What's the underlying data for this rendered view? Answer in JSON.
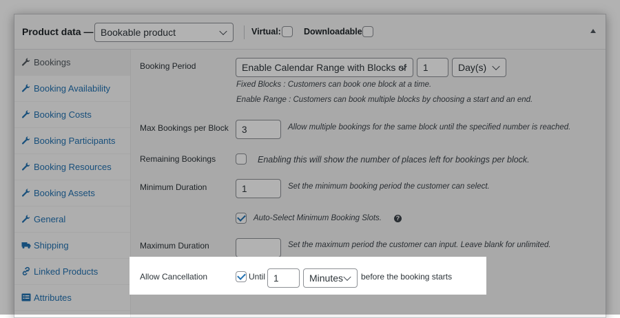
{
  "header": {
    "title": "Product data —",
    "product_type": "Bookable product",
    "virtual_label": "Virtual:",
    "downloadable_label": "Downloadable:"
  },
  "sidebar": {
    "items": [
      {
        "label": "Bookings",
        "icon": "wrench-icon",
        "active": true
      },
      {
        "label": "Booking Availability",
        "icon": "wrench-icon"
      },
      {
        "label": "Booking Costs",
        "icon": "wrench-icon"
      },
      {
        "label": "Booking Participants",
        "icon": "wrench-icon"
      },
      {
        "label": "Booking Resources",
        "icon": "wrench-icon"
      },
      {
        "label": "Booking Assets",
        "icon": "wrench-icon"
      },
      {
        "label": "General",
        "icon": "wrench-icon"
      },
      {
        "label": "Shipping",
        "icon": "truck-icon"
      },
      {
        "label": "Linked Products",
        "icon": "link-icon"
      },
      {
        "label": "Attributes",
        "icon": "list-icon"
      }
    ]
  },
  "fields": {
    "booking_period": {
      "label": "Booking Period",
      "mode": "Enable Calendar Range with Blocks of",
      "value": "1",
      "unit": "Day(s)",
      "desc1": "Fixed Blocks : Customers can book one block at a time.",
      "desc2": "Enable Range : Customers can book multiple blocks by choosing a start and an end."
    },
    "max_bookings": {
      "label": "Max Bookings per Block",
      "value": "3",
      "desc": "Allow multiple bookings for the same block until the specified number is reached."
    },
    "remaining": {
      "label": "Remaining Bookings",
      "desc": "Enabling this will show the number of places left for bookings per block."
    },
    "min_duration": {
      "label": "Minimum Duration",
      "value": "1",
      "desc": "Set the minimum booking period the customer can select.",
      "auto_select": "Auto-Select Minimum Booking Slots."
    },
    "max_duration": {
      "label": "Maximum Duration",
      "value": "",
      "desc": "Set the maximum period the customer can input. Leave blank for unlimited."
    },
    "cancellation": {
      "label": "Allow Cancellation",
      "until": "Until",
      "value": "1",
      "unit": "Minutes",
      "suffix": "before the booking starts"
    }
  },
  "colors": {
    "accent": "#2271b1",
    "overlay": "rgba(0,0,0,0.30)"
  }
}
